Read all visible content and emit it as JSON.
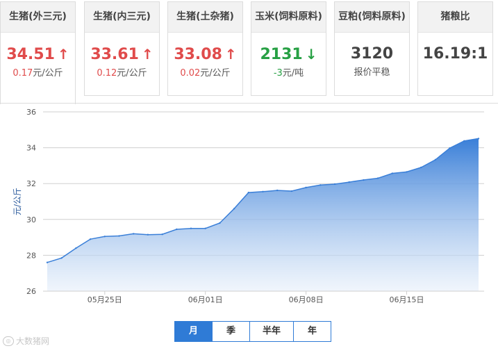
{
  "cards": [
    {
      "title": "生猪(外三元)",
      "price": "34.51",
      "arrow": "↑",
      "dir": "up",
      "change": "0.17",
      "unit": "元/公斤"
    },
    {
      "title": "生猪(内三元)",
      "price": "33.61",
      "arrow": "↑",
      "dir": "up",
      "change": "0.12",
      "unit": "元/公斤"
    },
    {
      "title": "生猪(土杂猪)",
      "price": "33.08",
      "arrow": "↑",
      "dir": "up",
      "change": "0.02",
      "unit": "元/公斤"
    },
    {
      "title": "玉米(饲料原料)",
      "price": "2131",
      "arrow": "↓",
      "dir": "down",
      "change": "-3",
      "unit": "元/吨"
    },
    {
      "title": "豆粕(饲料原料)",
      "price": "3120",
      "arrow": "",
      "dir": "flat",
      "change": "报价平稳",
      "unit": ""
    },
    {
      "title": "猪粮比",
      "price": "16.19:1",
      "arrow": "",
      "dir": "flat",
      "change": "",
      "unit": ""
    }
  ],
  "period_buttons": [
    "月",
    "季",
    "半年",
    "年"
  ],
  "selected_period": "月",
  "watermark": "大数猪网",
  "colors": {
    "up": "#e04b4b",
    "down": "#27a044",
    "accent": "#2f7bd6",
    "line": "#3a7fd8"
  },
  "chart_data": {
    "type": "area",
    "ylabel": "元/公斤",
    "xlabel": "",
    "ylim": [
      26,
      36
    ],
    "yticks": [
      26,
      28,
      30,
      32,
      34,
      36
    ],
    "x_tick_labels": [
      "05月25日",
      "06月01日",
      "06月08日",
      "06月15日"
    ],
    "x": [
      "05/21",
      "05/22",
      "05/23",
      "05/24",
      "05/25",
      "05/26",
      "05/27",
      "05/28",
      "05/29",
      "05/30",
      "05/31",
      "06/01",
      "06/02",
      "06/03",
      "06/04",
      "06/05",
      "06/06",
      "06/07",
      "06/08",
      "06/09",
      "06/10",
      "06/11",
      "06/12",
      "06/13",
      "06/14",
      "06/15",
      "06/16",
      "06/17",
      "06/18",
      "06/19",
      "06/20"
    ],
    "series": [
      {
        "values": [
          27.6,
          27.85,
          28.4,
          28.9,
          29.05,
          29.08,
          29.2,
          29.15,
          29.17,
          29.45,
          29.5,
          29.5,
          29.8,
          30.6,
          31.5,
          31.55,
          31.62,
          31.58,
          31.78,
          31.92,
          31.97,
          32.08,
          32.2,
          32.3,
          32.57,
          32.65,
          32.9,
          33.33,
          33.98,
          34.38,
          34.51
        ]
      }
    ],
    "grid": true
  }
}
